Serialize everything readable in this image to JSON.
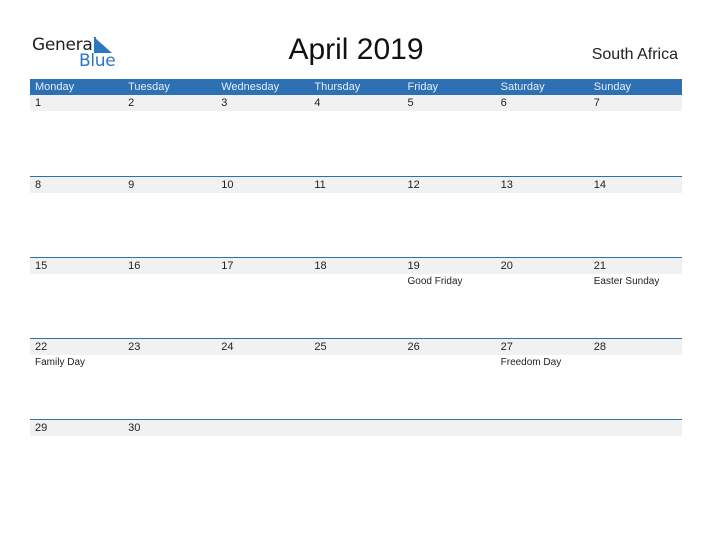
{
  "logo": {
    "text_general": "General",
    "text_blue": "Blue",
    "brand_color": "#2a77c2"
  },
  "header": {
    "title": "April 2019",
    "country": "South Africa"
  },
  "colors": {
    "header_bg": "#2e70b4",
    "number_bar_bg": "#f1f1f1"
  },
  "weekdays": [
    "Monday",
    "Tuesday",
    "Wednesday",
    "Thursday",
    "Friday",
    "Saturday",
    "Sunday"
  ],
  "weeks": [
    [
      {
        "day": "1",
        "holiday": ""
      },
      {
        "day": "2",
        "holiday": ""
      },
      {
        "day": "3",
        "holiday": ""
      },
      {
        "day": "4",
        "holiday": ""
      },
      {
        "day": "5",
        "holiday": ""
      },
      {
        "day": "6",
        "holiday": ""
      },
      {
        "day": "7",
        "holiday": ""
      }
    ],
    [
      {
        "day": "8",
        "holiday": ""
      },
      {
        "day": "9",
        "holiday": ""
      },
      {
        "day": "10",
        "holiday": ""
      },
      {
        "day": "11",
        "holiday": ""
      },
      {
        "day": "12",
        "holiday": ""
      },
      {
        "day": "13",
        "holiday": ""
      },
      {
        "day": "14",
        "holiday": ""
      }
    ],
    [
      {
        "day": "15",
        "holiday": ""
      },
      {
        "day": "16",
        "holiday": ""
      },
      {
        "day": "17",
        "holiday": ""
      },
      {
        "day": "18",
        "holiday": ""
      },
      {
        "day": "19",
        "holiday": "Good Friday"
      },
      {
        "day": "20",
        "holiday": ""
      },
      {
        "day": "21",
        "holiday": "Easter Sunday"
      }
    ],
    [
      {
        "day": "22",
        "holiday": "Family Day"
      },
      {
        "day": "23",
        "holiday": ""
      },
      {
        "day": "24",
        "holiday": ""
      },
      {
        "day": "25",
        "holiday": ""
      },
      {
        "day": "26",
        "holiday": ""
      },
      {
        "day": "27",
        "holiday": "Freedom Day"
      },
      {
        "day": "28",
        "holiday": ""
      }
    ],
    [
      {
        "day": "29",
        "holiday": ""
      },
      {
        "day": "30",
        "holiday": ""
      },
      {
        "day": "",
        "holiday": ""
      },
      {
        "day": "",
        "holiday": ""
      },
      {
        "day": "",
        "holiday": ""
      },
      {
        "day": "",
        "holiday": ""
      },
      {
        "day": "",
        "holiday": ""
      }
    ]
  ]
}
